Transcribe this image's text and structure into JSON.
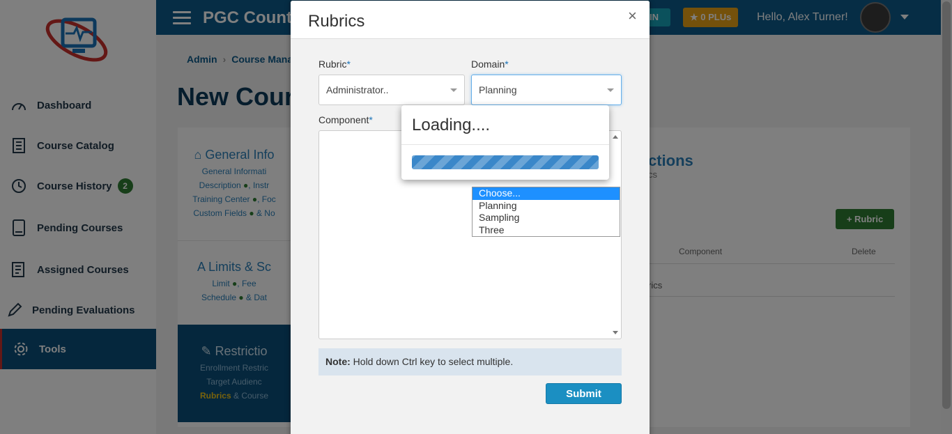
{
  "app": {
    "title": "PGC County"
  },
  "topbar": {
    "login_label": "IN",
    "plus_label": "0 PLUs",
    "greeting": "Hello, Alex Turner!"
  },
  "sidebar": {
    "items": [
      {
        "label": "Dashboard",
        "icon": "gauge-icon"
      },
      {
        "label": "Course Catalog",
        "icon": "catalog-icon"
      },
      {
        "label": "Course History",
        "icon": "history-icon",
        "badge": "2"
      },
      {
        "label": "Pending Courses",
        "icon": "tablet-icon"
      },
      {
        "label": "Assigned Courses",
        "icon": "clipboard-icon"
      },
      {
        "label": "Pending Evaluations",
        "icon": "pencil-icon"
      },
      {
        "label": "Tools",
        "icon": "gear-icon",
        "active": true
      }
    ]
  },
  "breadcrumb": {
    "item1": "Admin",
    "item2": "Course Mana"
  },
  "page": {
    "title": "New Cour"
  },
  "wizard": {
    "general": {
      "title": "General Info",
      "line1": "General Informati",
      "line2": "Description",
      "line2b": ", Instr",
      "line3": "Training Center",
      "line3b": ", Foc",
      "line4": "Custom Fields",
      "line4b": "& No"
    },
    "limits": {
      "title": "Limits & Sc",
      "line1": "Limit",
      "line1b": ", Fee",
      "line2": "Schedule",
      "line2b": "& Dat"
    },
    "restrictions": {
      "title": "Restrictio",
      "line1": "Enrollment Restric",
      "line2": "Target Audienc",
      "line3a": "Rubrics",
      "line3b": "& Course"
    }
  },
  "right_panel": {
    "title": "ctions",
    "subtitle": "cs",
    "add_button": "+ Rubric",
    "col_component": "Component",
    "col_delete": "Delete",
    "row_text": "rics"
  },
  "modal": {
    "title": "Rubrics",
    "close": "×",
    "rubric_label": "Rubric",
    "rubric_value": "Administrator..",
    "domain_label": "Domain",
    "domain_value": "Planning",
    "component_label": "Component",
    "required_mark": "*",
    "note_bold": "Note:",
    "note_text": " Hold down Ctrl key to select multiple.",
    "submit_label": "Submit"
  },
  "dropdown": {
    "options": [
      "Choose...",
      "Planning",
      "Sampling",
      "Three"
    ],
    "selected": "Choose..."
  },
  "loading": {
    "title": "Loading....",
    "progress": 1.0
  },
  "colors": {
    "primary": "#0d5a8a",
    "active_nav": "#0a4f7a",
    "accent_red": "#c9302c",
    "submit": "#1b8fc2",
    "progress": "#3a87c9",
    "plu": "#e8a317"
  }
}
